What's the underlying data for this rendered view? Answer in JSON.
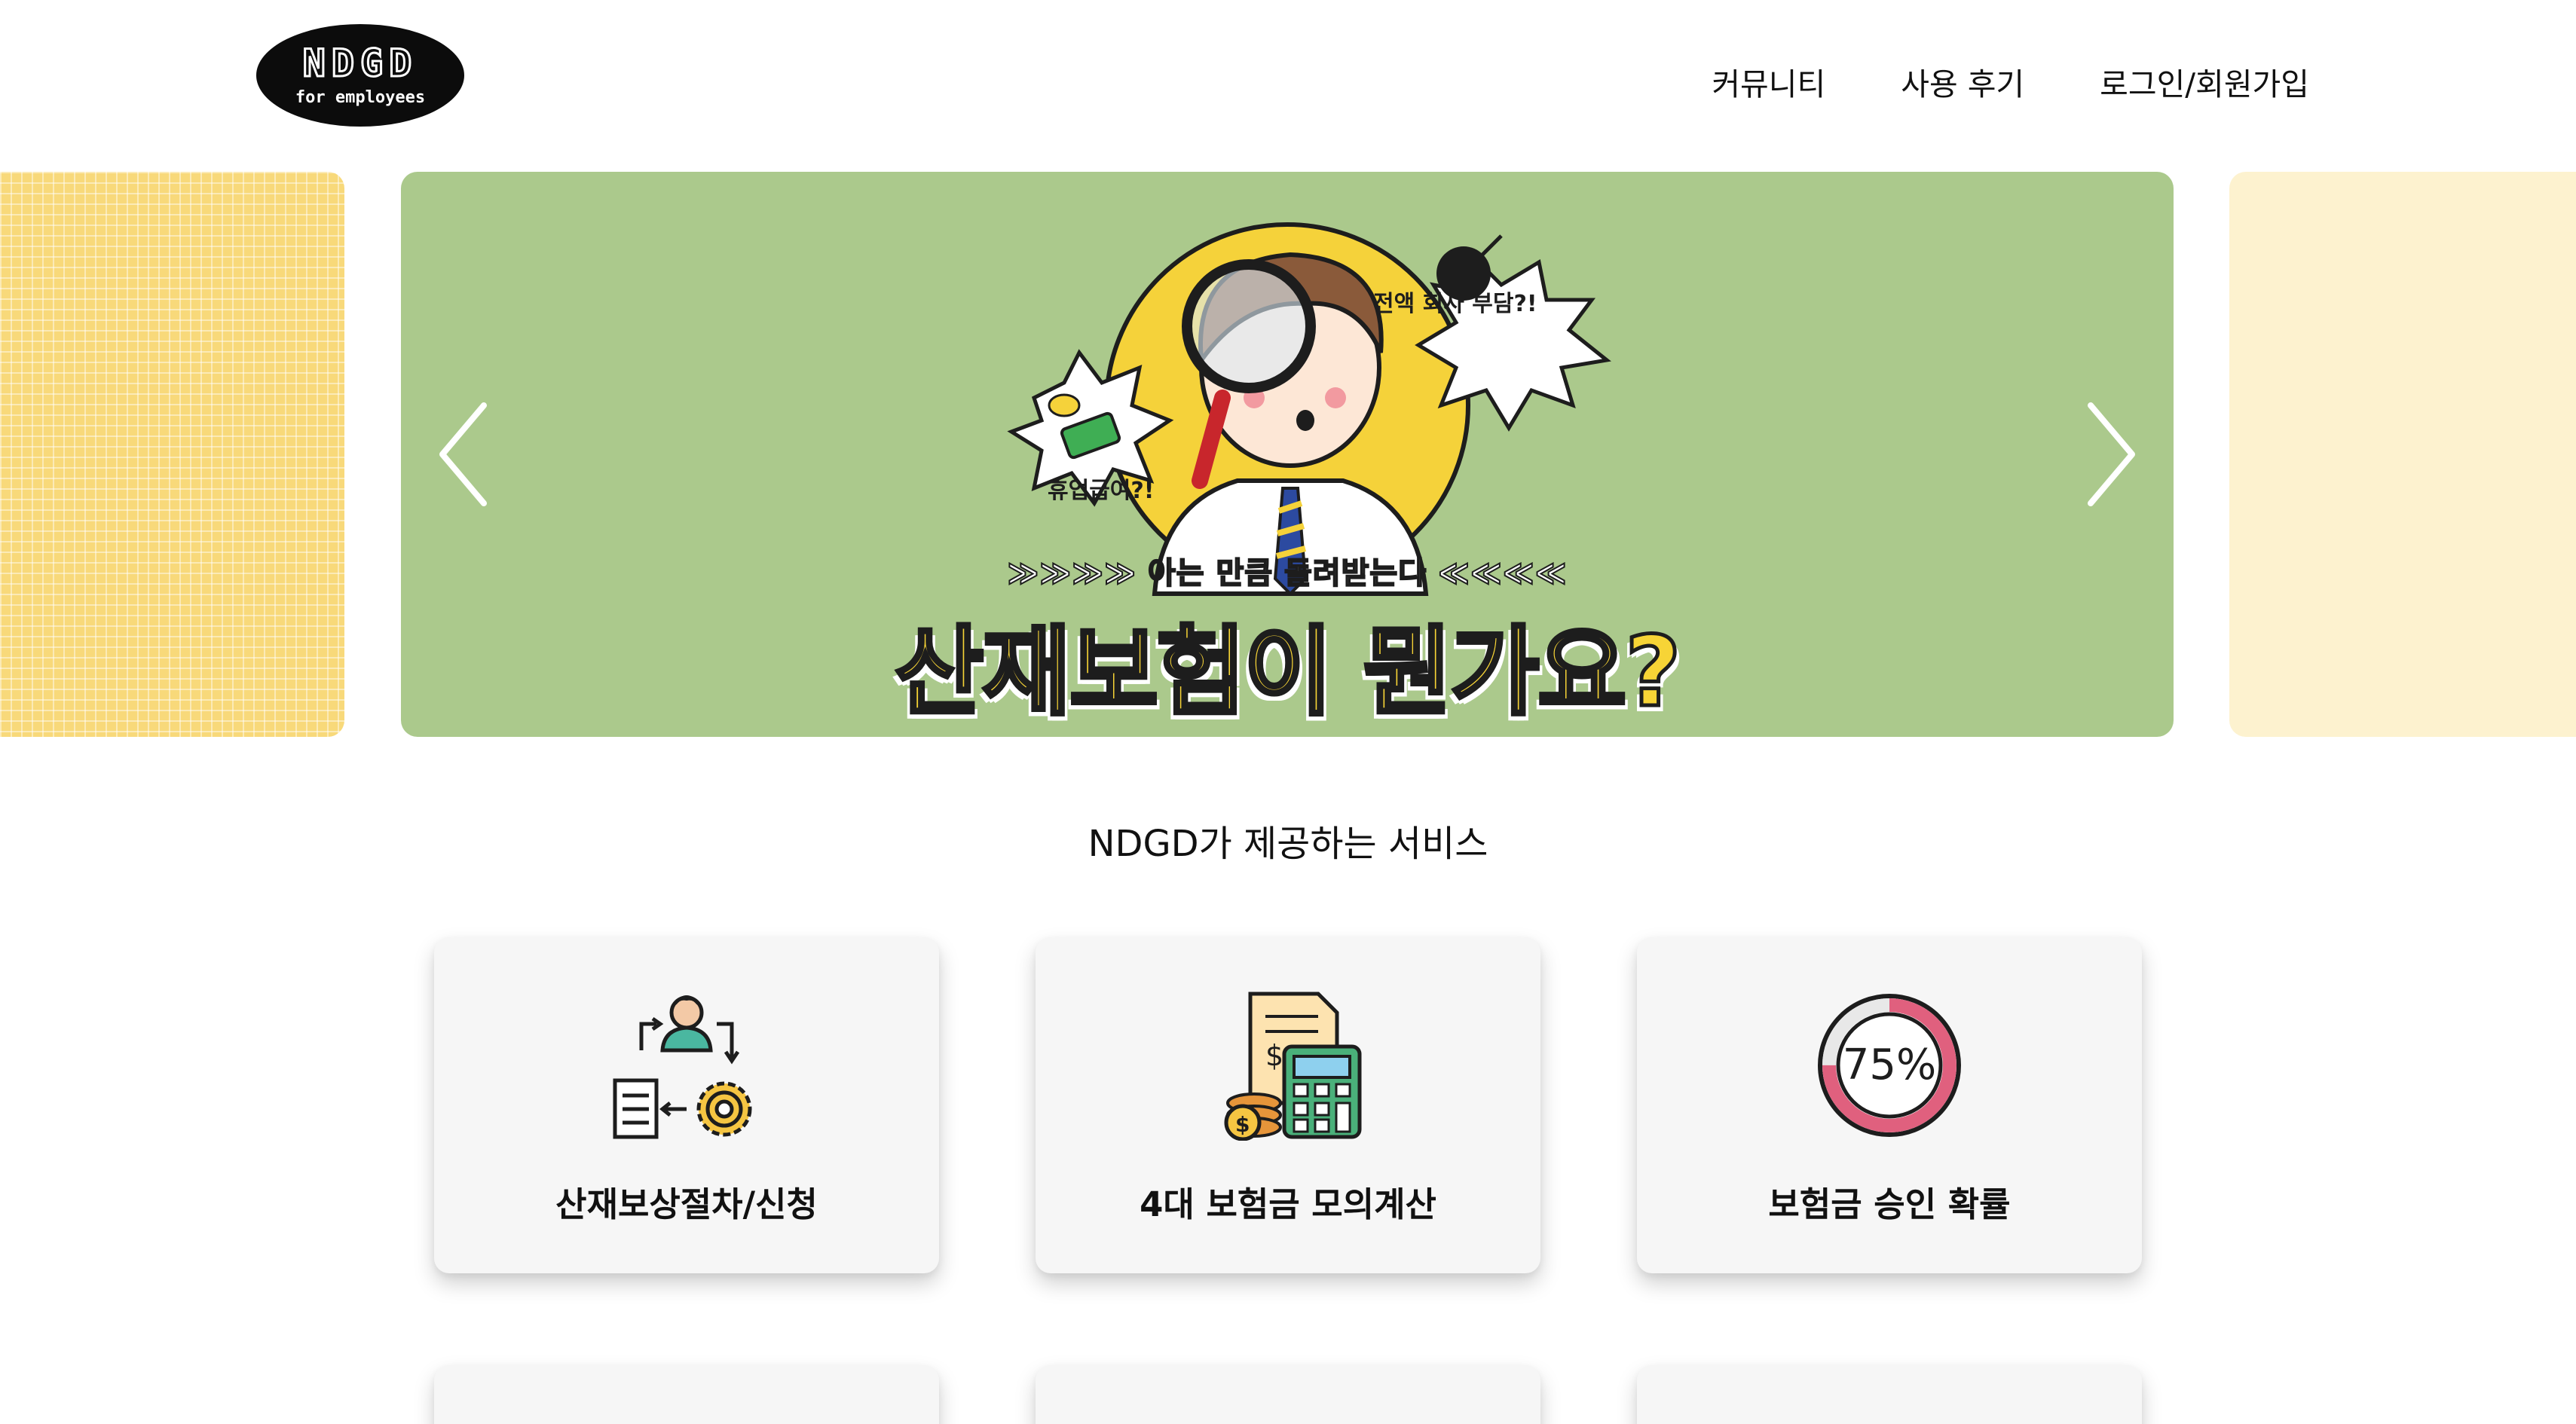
{
  "header": {
    "logo_text": "NDGD",
    "logo_subtext": "for employees",
    "nav": [
      {
        "label": "커뮤니티"
      },
      {
        "label": "사용 후기"
      },
      {
        "label": "로그인/회원가입"
      }
    ]
  },
  "carousel": {
    "banner_small": "≫≫≫≫ 아는 만큼 돌려받는다 ≪≪≪≪",
    "banner_title": "산재보험이 뭔가요?",
    "bubble_left": "휴업급여?!",
    "bubble_right": "전액 회사 부담?!",
    "colors": {
      "main": "#abc98c",
      "left": "#f8d97a",
      "right": "#fdf2cf"
    }
  },
  "services": {
    "title": "NDGD가 제공하는 서비스",
    "cards": [
      {
        "label": "산재보상절차/신청",
        "icon": "workflow-process-icon"
      },
      {
        "label": "4대 보험금 모의계산",
        "icon": "calculator-icon"
      },
      {
        "label": "보험금 승인 확률",
        "icon": "percent-gauge-icon",
        "gauge_text": "75%",
        "gauge_value": 0.75
      }
    ]
  }
}
